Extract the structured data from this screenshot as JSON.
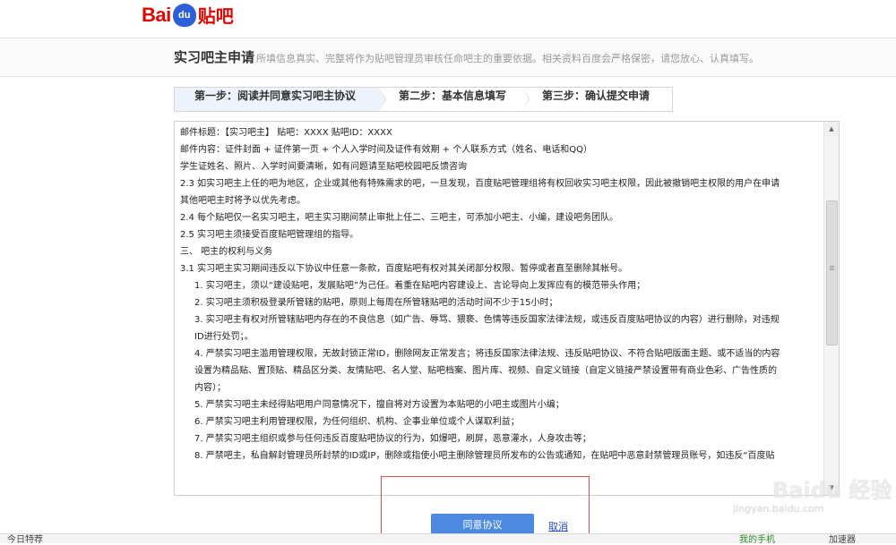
{
  "logo": {
    "bai": "Bai",
    "du": "du",
    "tieba": "贴吧"
  },
  "header": {
    "title": "实习吧主申请",
    "desc": "所填信息真实、完整将作为贴吧管理员审核任命吧主的重要依据。相关资料百度会严格保密，请您放心、认真填写。"
  },
  "steps": [
    {
      "label": "第一步：阅读并同意实习吧主协议"
    },
    {
      "label": "第二步：基本信息填写"
    },
    {
      "label": "第三步：确认提交申请"
    }
  ],
  "agreement": {
    "lines": [
      "邮件标题：【实习吧主】 贴吧：XXXX 贴吧ID：XXXX",
      "邮件内容：证件封面 + 证件第一页 + 个人入学时间及证件有效期 + 个人联系方式（姓名、电话和QQ）",
      "学生证姓名、照片、入学时间要清晰，如有问题请至贴吧校园吧反馈咨询",
      "2.3 如实习吧主上任的吧为地区，企业或其他有特殊需求的吧，一旦发现，百度贴吧管理组将有权回收实习吧主权限，因此被撤销吧主权限的用户在申请",
      "其他吧吧主时将予以优先考虑。",
      "2.4 每个贴吧仅一名实习吧主，吧主实习期间禁止审批上任二、三吧主，可添加小吧主、小编，建设吧务团队。",
      "2.5 实习吧主须接受百度贴吧管理组的指导。",
      "三、 吧主的权利与义务",
      "3.1 实习吧主实习期间违反以下协议中任意一条款，百度贴吧有权对其关闭部分权限、暂停或者直至删除其帐号。",
      "1. 实习吧主，须以“建设贴吧，发展贴吧”为己任。着重在贴吧内容建设上、言论导向上发挥应有的模范带头作用；",
      "2. 实习吧主须积极登录所管辖的贴吧，原则上每周在所管辖贴吧的活动时间不少于15小时；",
      "3. 实习吧主有权对所管辖贴吧内存在的不良信息（如广告、辱骂、猥亵、色情等违反国家法律法规，或违反百度贴吧协议的内容）进行删除，对违规",
      "ID进行处罚；。",
      "4. 严禁实习吧主滥用管理权限，无故封锁正常ID，删除网友正常发言；将违反国家法律法规、违反贴吧协议、不符合贴吧版面主题、或不适当的内容",
      "设置为精品贴、置顶贴、精品区分类、友情贴吧、名人堂、贴吧档案、图片库、视频、自定义链接（自定义链接严禁设置带有商业色彩、广告性质的",
      "内容）；",
      "5. 严禁实习吧主未经得贴吧用户同意情况下，擅自将对方设置为本贴吧的小吧主或图片小编；",
      "6. 严禁实习吧主利用管理权限，为任何组织、机构、企事业单位或个人谋取利益；",
      "7. 严禁实习吧主组织或参与任何违反百度贴吧协议的行为，如爆吧，刷屏，恶意灌水，人身攻击等；",
      "8. 严禁吧主，私自解封管理员所封禁的ID或IP，删除或指使小吧主删除管理员所发布的公告或通知，在贴吧中恶意封禁管理员账号，如违反“百度贴"
    ]
  },
  "scrollbar": {
    "up_arrow": "▲",
    "down_arrow": "▼"
  },
  "actions": {
    "agree_label": "同意协议",
    "cancel_label": "取消"
  },
  "watermark": {
    "title": "Baidu 经验",
    "url": "jingyan.baidu.com"
  },
  "bottom_bar": {
    "left": "今日特荐",
    "mid": "我的手机",
    "right": "加速器"
  },
  "colors": {
    "brand_red": "#e10602",
    "brand_blue": "#2e5fd8",
    "button_blue": "#4b8ae0",
    "highlight_red": "#e25050"
  }
}
